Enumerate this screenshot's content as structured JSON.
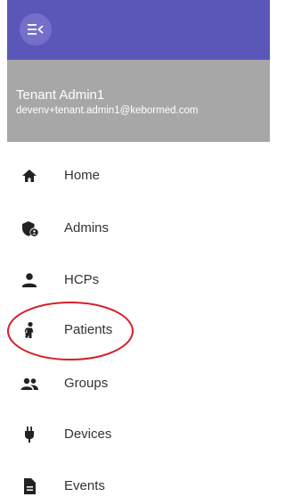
{
  "user": {
    "name": "Tenant Admin1",
    "email": "devenv+tenant.admin1@kebormed.com"
  },
  "nav": {
    "items": [
      {
        "label": "Home",
        "icon": "home-icon"
      },
      {
        "label": "Admins",
        "icon": "admin-shield-icon"
      },
      {
        "label": "HCPs",
        "icon": "person-icon"
      },
      {
        "label": "Patients",
        "icon": "patient-icon"
      },
      {
        "label": "Groups",
        "icon": "group-icon"
      },
      {
        "label": "Devices",
        "icon": "plug-icon"
      },
      {
        "label": "Events",
        "icon": "document-icon"
      }
    ]
  },
  "colors": {
    "header": "#5b57b8",
    "toggle": "#7470c9",
    "user_panel": "#a7a7a7",
    "icon": "#222222",
    "highlight_annotation": "#d61f26"
  },
  "annotation": {
    "highlighted_item": "Patients"
  }
}
